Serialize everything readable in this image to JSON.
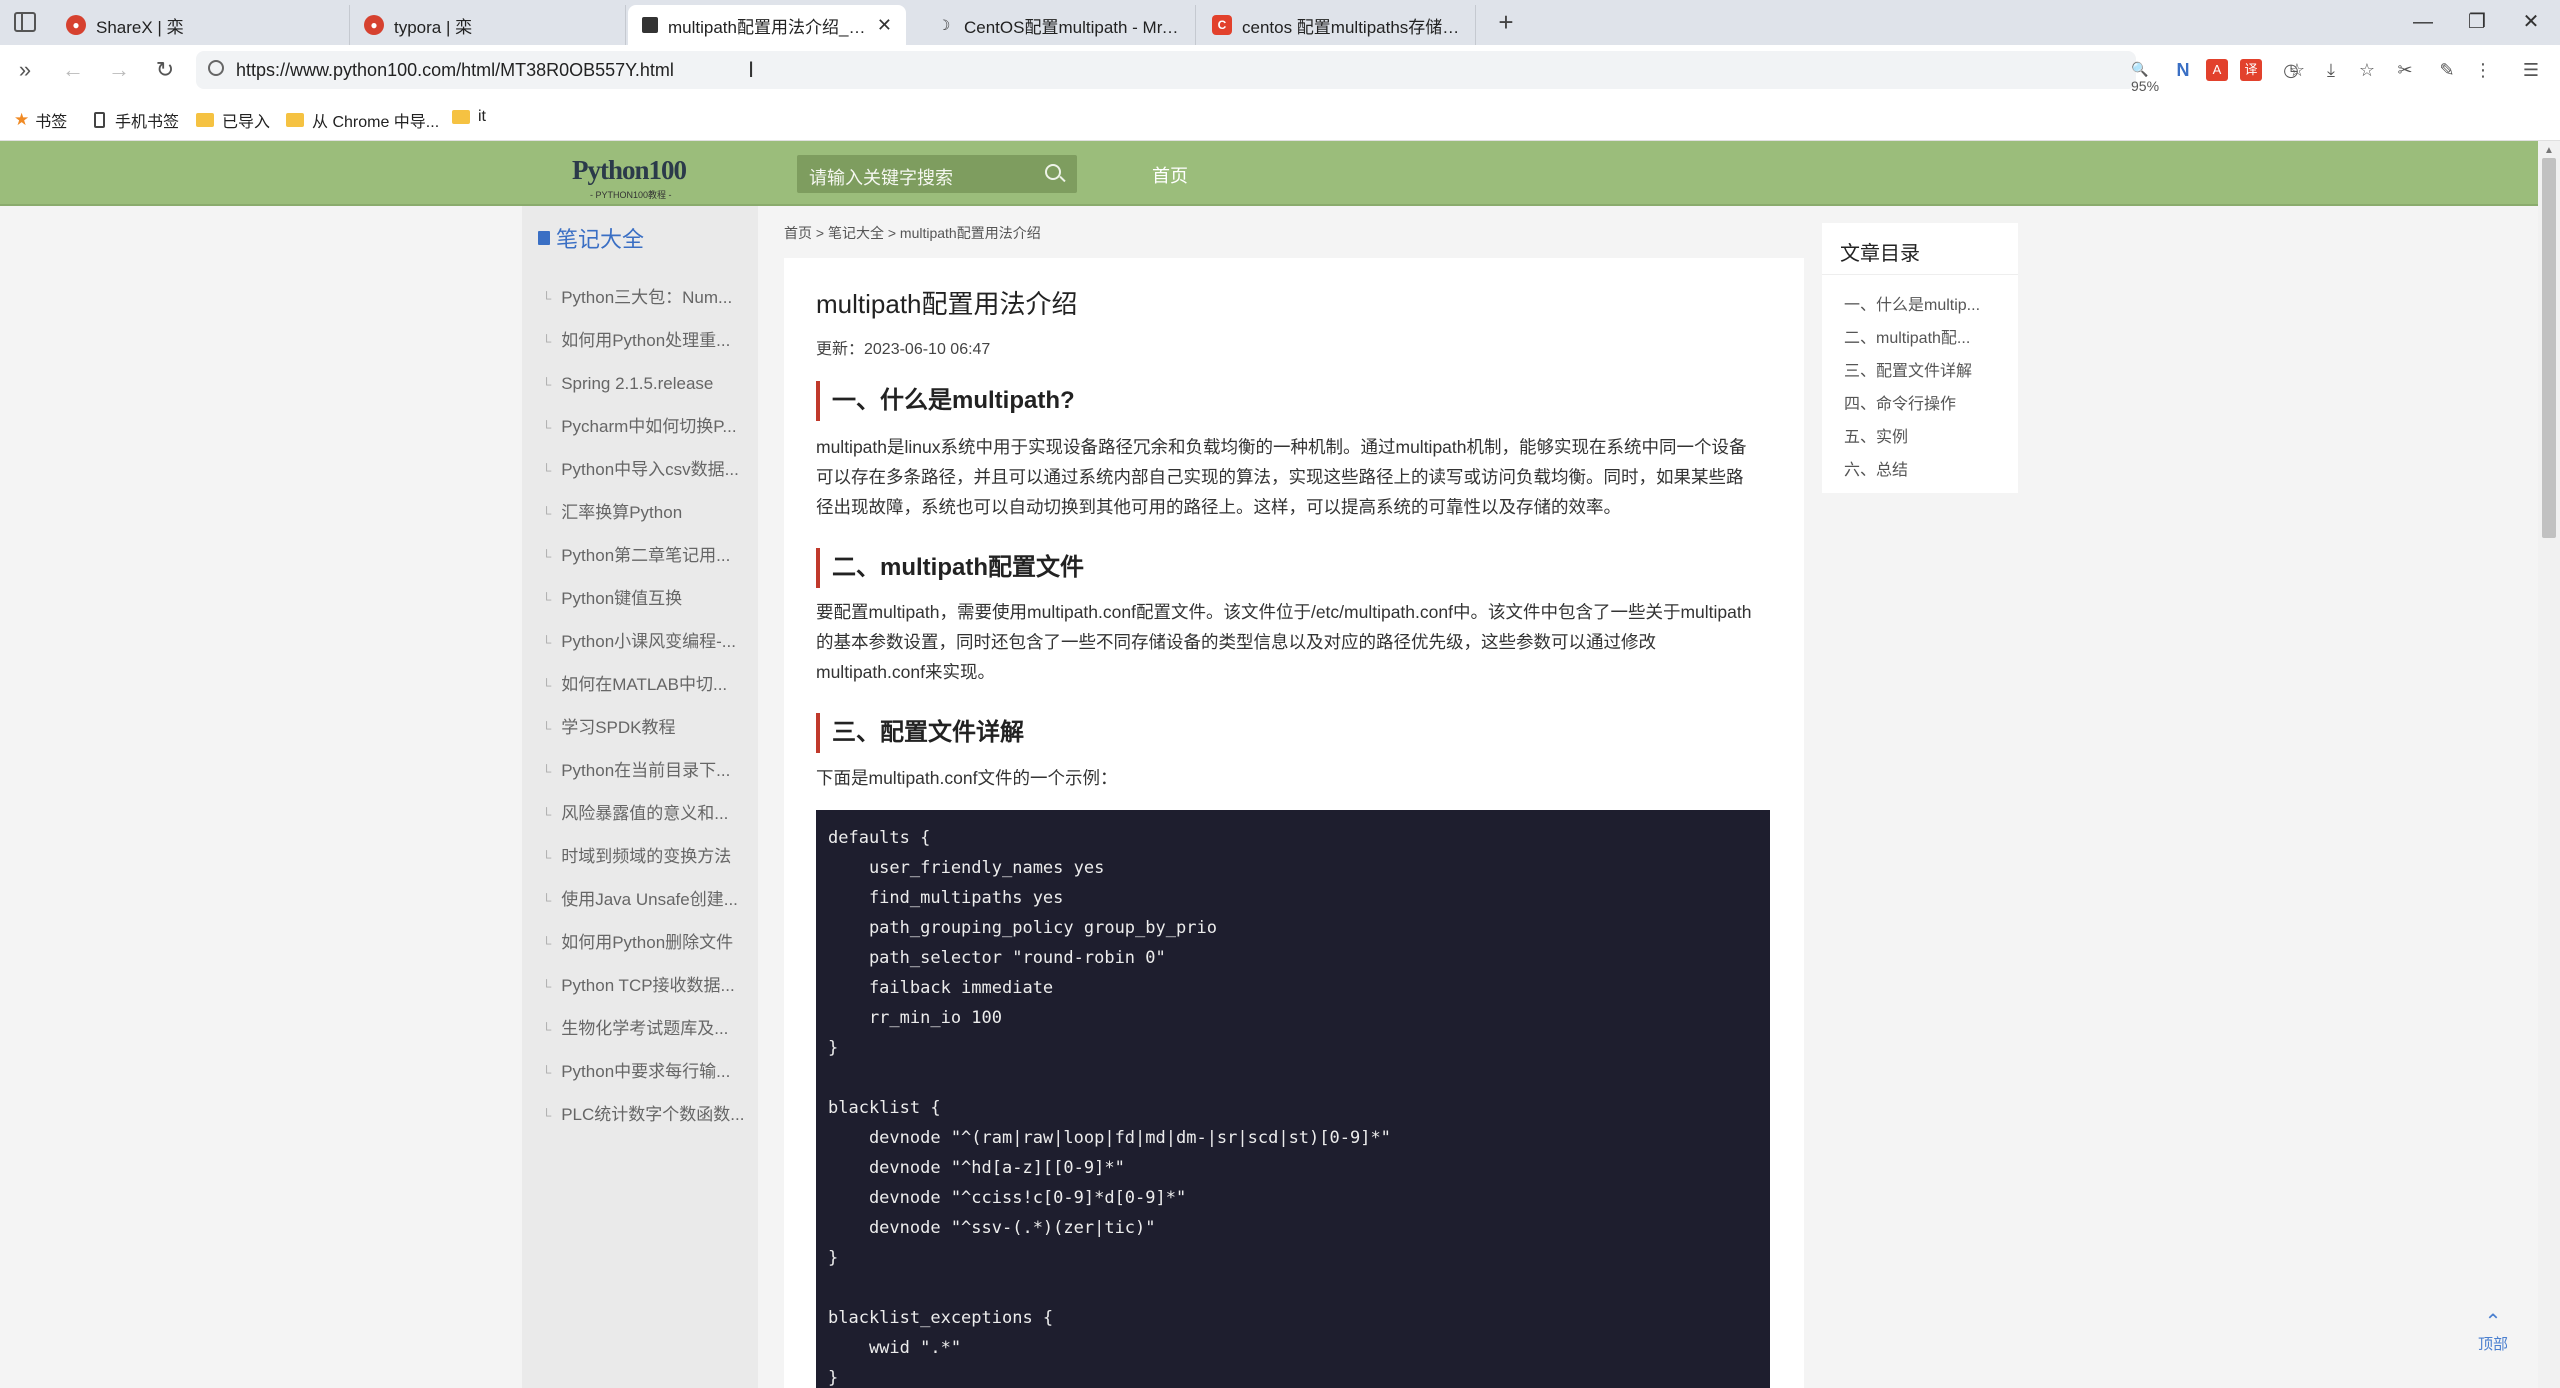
{
  "browser": {
    "tabs": [
      {
        "label": "ShareX | 栾",
        "active": false,
        "icon": "logo-icon"
      },
      {
        "label": "typora | 栾",
        "active": false,
        "icon": "logo-icon"
      },
      {
        "label": "multipath配置用法介绍_笔记大全",
        "active": true,
        "icon": "page-icon"
      },
      {
        "label": "CentOS配置multipath - Mr.Bob",
        "active": false,
        "icon": "moon-icon"
      },
      {
        "label": "centos 配置multipaths存储多路",
        "active": false,
        "icon": "csdn-icon"
      }
    ],
    "url": "https://www.python100.com/html/MT38R0OB557Y.html",
    "zoom": "95%",
    "bookmarks": [
      "书签",
      "手机书签",
      "已导入",
      "从 Chrome 中导...",
      "it"
    ]
  },
  "site": {
    "logo": "Python100",
    "logo_sub": "- PYTHON100教程 -",
    "search_placeholder": "请输入关键字搜索",
    "nav_home": "首页"
  },
  "sidebar": {
    "title": "笔记大全",
    "items": [
      "Python三大包：Num...",
      "如何用Python处理重...",
      "Spring 2.1.5.release",
      "Pycharm中如何切换P...",
      "Python中导入csv数据...",
      "汇率换算Python",
      "Python第二章笔记用...",
      "Python键值互换",
      "Python小课风变编程-...",
      "如何在MATLAB中切...",
      "学习SPDK教程",
      "Python在当前目录下...",
      "风险暴露值的意义和...",
      "时域到频域的变换方法",
      "使用Java Unsafe创建...",
      "如何用Python删除文件",
      "Python TCP接收数据...",
      "生物化学考试题库及...",
      "Python中要求每行输...",
      "PLC统计数字个数函数..."
    ]
  },
  "breadcrumb": "首页 > 笔记大全 > multipath配置用法介绍",
  "article": {
    "title": "multipath配置用法介绍",
    "date": "更新：2023-06-10 06:47",
    "h1": "一、什么是multipath?",
    "p1": "multipath是linux系统中用于实现设备路径冗余和负载均衡的一种机制。通过multipath机制，能够实现在系统中同一个设备可以存在多条路径，并且可以通过系统内部自己实现的算法，实现这些路径上的读写或访问负载均衡。同时，如果某些路径出现故障，系统也可以自动切换到其他可用的路径上。这样，可以提高系统的可靠性以及存储的效率。",
    "h2": "二、multipath配置文件",
    "p2": "要配置multipath，需要使用multipath.conf配置文件。该文件位于/etc/multipath.conf中。该文件中包含了一些关于multipath的基本参数设置，同时还包含了一些不同存储设备的类型信息以及对应的路径优先级，这些参数可以通过修改multipath.conf来实现。",
    "h3": "三、配置文件详解",
    "p3": "下面是multipath.conf文件的一个示例：",
    "code": "defaults {\n    user_friendly_names yes\n    find_multipaths yes\n    path_grouping_policy group_by_prio\n    path_selector \"round-robin 0\"\n    failback immediate\n    rr_min_io 100\n}\n\nblacklist {\n    devnode \"^(ram|raw|loop|fd|md|dm-|sr|scd|st)[0-9]*\"\n    devnode \"^hd[a-z][[0-9]*\"\n    devnode \"^cciss!c[0-9]*d[0-9]*\"\n    devnode \"^ssv-(.*)(zer|tic)\"\n}\n\nblacklist_exceptions {\n    wwid \".*\"\n}"
  },
  "toc": {
    "title": "文章目录",
    "items": [
      "一、什么是multip...",
      "二、multipath配...",
      "三、配置文件详解",
      "四、命令行操作",
      "五、实例",
      "六、总结"
    ]
  },
  "to_top": "顶部",
  "colors": {
    "header": "#9bbd7b",
    "accent": "#c0392b",
    "link": "#3a6fc4",
    "code_bg": "#1e1e2e"
  }
}
